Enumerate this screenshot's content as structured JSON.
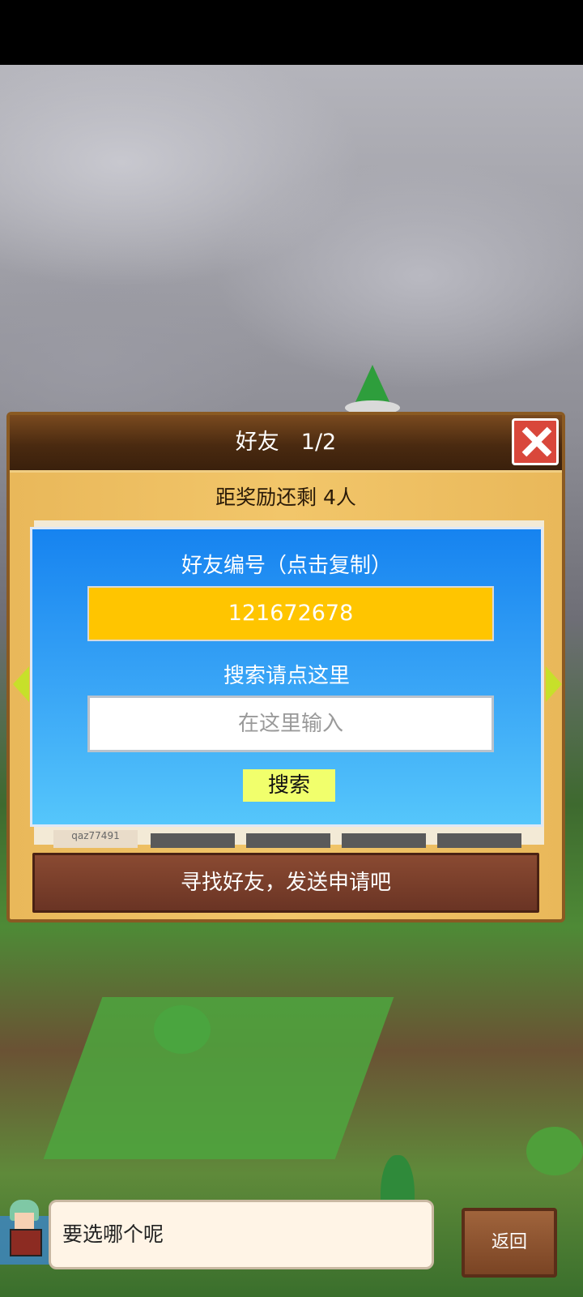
{
  "dialog": {
    "title": "好友　1/2",
    "reward_text": "距奖励还剩 4人",
    "slot_label": "qaz77491",
    "send_request_label": "寻找好友，发送申请吧"
  },
  "popup": {
    "id_label": "好友编号（点击复制）",
    "friend_id": "121672678",
    "search_label": "搜索请点这里",
    "search_placeholder": "在这里输入",
    "search_button": "搜索"
  },
  "bottom": {
    "speech": "要选哪个呢",
    "back_label": "返回"
  },
  "colors": {
    "accent_yellow": "#ffc500",
    "popup_blue": "#1683f0",
    "close_red": "#d9473b"
  }
}
